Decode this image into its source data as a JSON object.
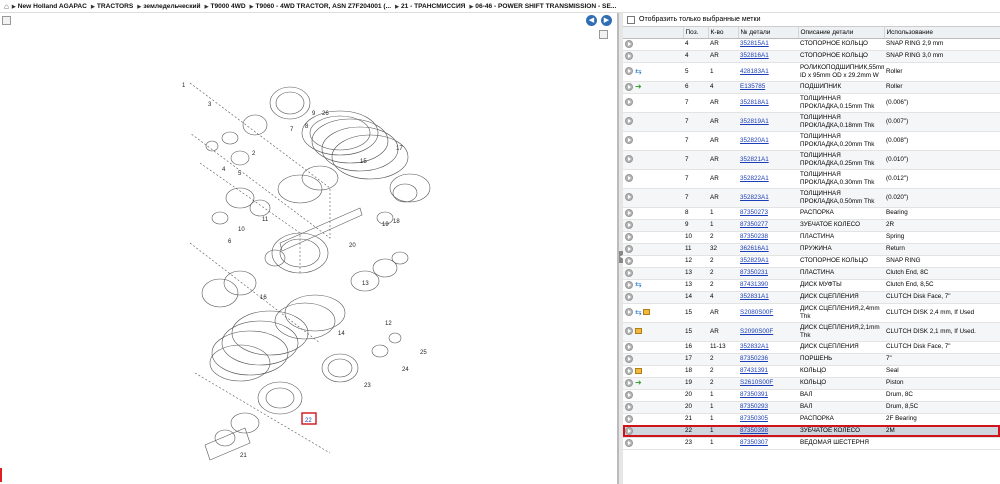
{
  "breadcrumb": {
    "items": [
      "New Holland AGAPAC",
      "TRACTORS",
      "земледельческий",
      "T9000 4WD",
      "T9060 - 4WD TRACTOR, ASN Z7F204001 (...",
      "21 - ТРАНСМИССИЯ",
      "06-46 - POWER SHIFT TRANSMISSION - SE..."
    ]
  },
  "diagram": {
    "callouts": [
      "1",
      "2",
      "3",
      "4",
      "5",
      "6",
      "7",
      "8",
      "9",
      "10",
      "11",
      "12",
      "13",
      "14",
      "15",
      "16",
      "17",
      "18",
      "19",
      "20",
      "21",
      "22",
      "23",
      "24",
      "25",
      "26"
    ],
    "selected_callout": "22"
  },
  "filter_label": "Отобразить только выбранные метки",
  "columns": {
    "pos": "Поз.",
    "qty": "К-во",
    "part": "№ детали",
    "desc": "Описание детали",
    "use": "Использование"
  },
  "rows": [
    {
      "icons": "",
      "pos": "4",
      "qty": "AR",
      "part": "352815A1",
      "desc": "СТОПОРНОЕ КОЛЬЦО",
      "use": "SNAP RING 2,9 mm"
    },
    {
      "icons": "",
      "pos": "4",
      "qty": "AR",
      "part": "352816A1",
      "desc": "СТОПОРНОЕ КОЛЬЦО",
      "use": "SNAP RING 3,0 mm"
    },
    {
      "icons": "swap",
      "pos": "5",
      "qty": "1",
      "part": "428183A1",
      "desc": "РОЛИКОПОДШИПНИК,55mm ID x 95mm OD x 29.2mm W",
      "use": "Roller"
    },
    {
      "icons": "upd",
      "pos": "6",
      "qty": "4",
      "part": "E135785",
      "desc": "ПОДШИПНИК",
      "use": "Roller"
    },
    {
      "icons": "",
      "pos": "7",
      "qty": "AR",
      "part": "352818A1",
      "desc": "ТОЛЩИННАЯ ПРОКЛАДКА,0.15mm Thk",
      "use": "(0.006\")"
    },
    {
      "icons": "",
      "pos": "7",
      "qty": "AR",
      "part": "352819A1",
      "desc": "ТОЛЩИННАЯ ПРОКЛАДКА,0.18mm Thk",
      "use": "(0.007\")"
    },
    {
      "icons": "",
      "pos": "7",
      "qty": "AR",
      "part": "352820A1",
      "desc": "ТОЛЩИННАЯ ПРОКЛАДКА,0.20mm Thk",
      "use": "(0.008\")"
    },
    {
      "icons": "",
      "pos": "7",
      "qty": "AR",
      "part": "352821A1",
      "desc": "ТОЛЩИННАЯ ПРОКЛАДКА,0.25mm Thk",
      "use": "(0.010\")"
    },
    {
      "icons": "",
      "pos": "7",
      "qty": "AR",
      "part": "352822A1",
      "desc": "ТОЛЩИННАЯ ПРОКЛАДКА,0.30mm Thk",
      "use": "(0.012\")"
    },
    {
      "icons": "",
      "pos": "7",
      "qty": "AR",
      "part": "352823A1",
      "desc": "ТОЛЩИННАЯ ПРОКЛАДКА,0.50mm Thk",
      "use": "(0.020\")"
    },
    {
      "icons": "",
      "pos": "8",
      "qty": "1",
      "part": "87350273",
      "desc": "РАСПОРКА",
      "use": "Bearing"
    },
    {
      "icons": "",
      "pos": "9",
      "qty": "1",
      "part": "87350277",
      "desc": "ЗУБЧАТОЕ КОЛЕСО",
      "use": "2R"
    },
    {
      "icons": "",
      "pos": "10",
      "qty": "2",
      "part": "87350238",
      "desc": "ПЛАСТИНА",
      "use": "Spring"
    },
    {
      "icons": "",
      "pos": "11",
      "qty": "32",
      "part": "362616A1",
      "desc": "ПРУЖИНА",
      "use": "Return"
    },
    {
      "icons": "",
      "pos": "12",
      "qty": "2",
      "part": "352829A1",
      "desc": "СТОПОРНОЕ КОЛЬЦО",
      "use": "SNAP RING"
    },
    {
      "icons": "",
      "pos": "13",
      "qty": "2",
      "part": "87350231",
      "desc": "ПЛАСТИНА",
      "use": "Clutch End, 8C"
    },
    {
      "icons": "swap",
      "pos": "13",
      "qty": "2",
      "part": "87431390",
      "desc": "ДИСК МУФТЫ",
      "use": "Clutch End, 8,5C"
    },
    {
      "icons": "",
      "pos": "14",
      "qty": "4",
      "part": "352831A1",
      "desc": "ДИСК СЦЕПЛЕНИЯ",
      "use": "CLUTCH Disk Face, 7\""
    },
    {
      "icons": "swapbox",
      "pos": "15",
      "qty": "AR",
      "part": "S2080S00F",
      "desc": "ДИСК СЦЕПЛЕНИЯ,2,4mm Thk",
      "use": "CLUTCH DISK 2,4 mm, If Used"
    },
    {
      "icons": "box",
      "pos": "15",
      "qty": "AR",
      "part": "S2090S00F",
      "desc": "ДИСК СЦЕПЛЕНИЯ,2,1mm Thk",
      "use": "CLUTCH DISK 2,1 mm, If Used."
    },
    {
      "icons": "",
      "pos": "16",
      "qty": "11-13",
      "part": "352832A1",
      "desc": "ДИСК СЦЕПЛЕНИЯ",
      "use": "CLUTCH Disk Face, 7\""
    },
    {
      "icons": "",
      "pos": "17",
      "qty": "2",
      "part": "87350236",
      "desc": "ПОРШЕНЬ",
      "use": "7\""
    },
    {
      "icons": "box",
      "pos": "18",
      "qty": "2",
      "part": "87431391",
      "desc": "КОЛЬЦО",
      "use": "Seal"
    },
    {
      "icons": "upd",
      "pos": "19",
      "qty": "2",
      "part": "S2610S00F",
      "desc": "КОЛЬЦО",
      "use": "Piston"
    },
    {
      "icons": "",
      "pos": "20",
      "qty": "1",
      "part": "87350391",
      "desc": "ВАЛ",
      "use": "Drum, 8C"
    },
    {
      "icons": "",
      "pos": "20",
      "qty": "1",
      "part": "87350293",
      "desc": "ВАЛ",
      "use": "Drum, 8,5C"
    },
    {
      "icons": "",
      "pos": "21",
      "qty": "1",
      "part": "87350305",
      "desc": "РАСПОРКА",
      "use": "2F Bearing"
    },
    {
      "icons": "",
      "pos": "22",
      "qty": "1",
      "part": "87350398",
      "desc": "ЗУБЧАТОЕ КОЛЕСО",
      "use": "2M",
      "selected": true
    },
    {
      "icons": "",
      "pos": "23",
      "qty": "1",
      "part": "87350307",
      "desc": "ВЕДОМАЯ ШЕСТЕРНЯ",
      "use": ""
    }
  ]
}
